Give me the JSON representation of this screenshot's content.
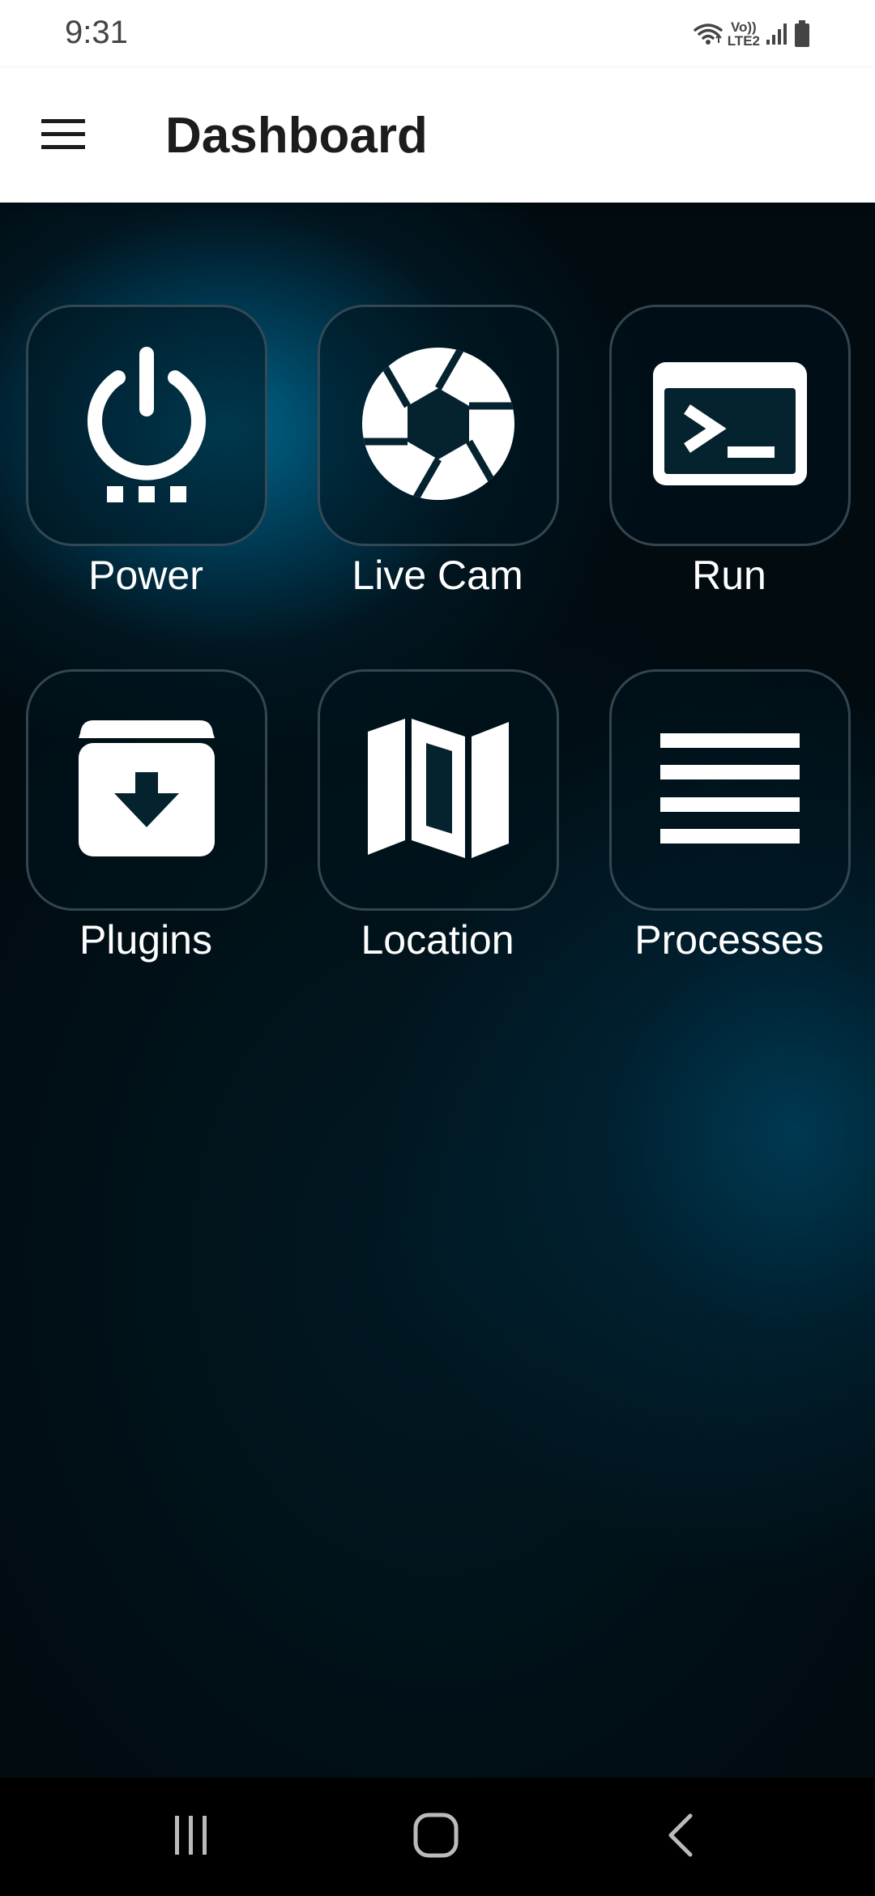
{
  "status_bar": {
    "time": "9:31",
    "volte_top": "Vo))",
    "volte_bottom": "LTE2",
    "icons": [
      "wifi-icon",
      "volte-icon",
      "signal-icon",
      "battery-icon"
    ]
  },
  "app_bar": {
    "menu_icon": "hamburger-menu-icon",
    "title": "Dashboard"
  },
  "tiles": [
    {
      "label": "Power",
      "icon": "power-icon"
    },
    {
      "label": "Live Cam",
      "icon": "aperture-icon"
    },
    {
      "label": "Run",
      "icon": "terminal-icon"
    },
    {
      "label": "Plugins",
      "icon": "archive-download-icon"
    },
    {
      "label": "Location",
      "icon": "map-icon"
    },
    {
      "label": "Processes",
      "icon": "list-icon"
    }
  ],
  "nav_bar": {
    "icons": [
      "recent-apps-icon",
      "home-icon",
      "back-icon"
    ]
  },
  "colors": {
    "app_bar_bg": "#ffffff",
    "title_text": "#1c1c1c",
    "tile_border": "#3c505c",
    "tile_icon": "#ffffff",
    "background_accent": "#00688e",
    "nav_bar_bg": "#000000"
  }
}
